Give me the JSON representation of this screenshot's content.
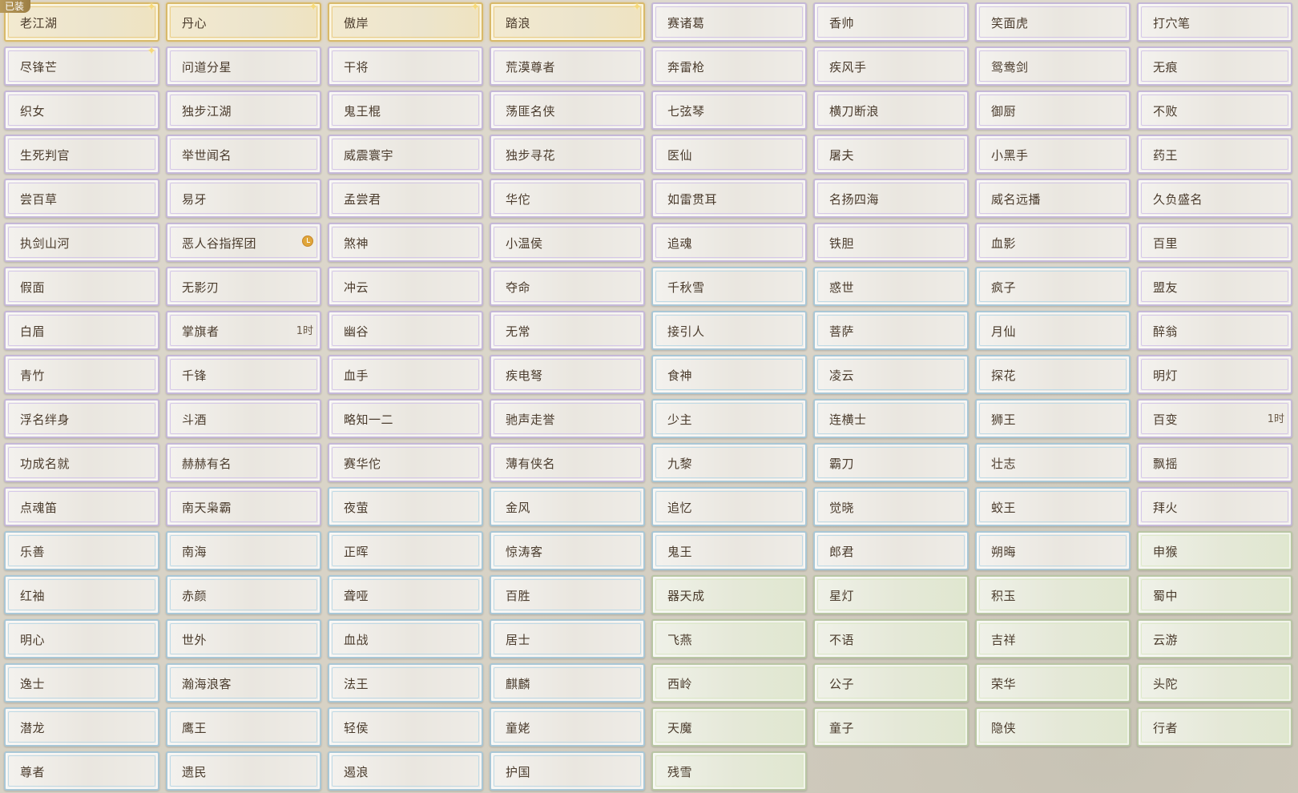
{
  "equipped_badge": "已装",
  "titles": [
    {
      "name": "老江湖",
      "style": "gold",
      "spark": true
    },
    {
      "name": "丹心",
      "style": "gold",
      "spark": true
    },
    {
      "name": "傲岸",
      "style": "gold",
      "spark": true
    },
    {
      "name": "踏浪",
      "style": "gold",
      "spark": true
    },
    {
      "name": "赛诸葛",
      "style": "purple"
    },
    {
      "name": "香帅",
      "style": "purple"
    },
    {
      "name": "笑面虎",
      "style": "purple"
    },
    {
      "name": "打穴笔",
      "style": "purple"
    },
    {
      "name": "尽锋芒",
      "style": "purple",
      "spark": true
    },
    {
      "name": "问道分星",
      "style": "purple"
    },
    {
      "name": "干将",
      "style": "purple"
    },
    {
      "name": "荒漠尊者",
      "style": "purple"
    },
    {
      "name": "奔雷枪",
      "style": "purple"
    },
    {
      "name": "疾风手",
      "style": "purple"
    },
    {
      "name": "鸳鸯剑",
      "style": "purple"
    },
    {
      "name": "无痕",
      "style": "purple"
    },
    {
      "name": "织女",
      "style": "purple"
    },
    {
      "name": "独步江湖",
      "style": "purple"
    },
    {
      "name": "鬼王棍",
      "style": "purple"
    },
    {
      "name": "荡匪名侠",
      "style": "purple"
    },
    {
      "name": "七弦琴",
      "style": "purple"
    },
    {
      "name": "横刀断浪",
      "style": "purple"
    },
    {
      "name": "御厨",
      "style": "purple"
    },
    {
      "name": "不败",
      "style": "purple"
    },
    {
      "name": "生死判官",
      "style": "purple"
    },
    {
      "name": "举世闻名",
      "style": "purple"
    },
    {
      "name": "威震寰宇",
      "style": "purple"
    },
    {
      "name": "独步寻花",
      "style": "purple"
    },
    {
      "name": "医仙",
      "style": "purple"
    },
    {
      "name": "屠夫",
      "style": "purple"
    },
    {
      "name": "小黑手",
      "style": "purple"
    },
    {
      "name": "药王",
      "style": "purple"
    },
    {
      "name": "尝百草",
      "style": "purple"
    },
    {
      "name": "易牙",
      "style": "purple"
    },
    {
      "name": "孟尝君",
      "style": "purple"
    },
    {
      "name": "华佗",
      "style": "purple"
    },
    {
      "name": "如雷贯耳",
      "style": "purple"
    },
    {
      "name": "名扬四海",
      "style": "purple"
    },
    {
      "name": "威名远播",
      "style": "purple"
    },
    {
      "name": "久负盛名",
      "style": "purple"
    },
    {
      "name": "执剑山河",
      "style": "purple"
    },
    {
      "name": "恶人谷指挥团",
      "style": "purple",
      "timer": true
    },
    {
      "name": "煞神",
      "style": "purple"
    },
    {
      "name": "小温侯",
      "style": "purple"
    },
    {
      "name": "追魂",
      "style": "purple"
    },
    {
      "name": "铁胆",
      "style": "purple"
    },
    {
      "name": "血影",
      "style": "purple"
    },
    {
      "name": "百里",
      "style": "purple"
    },
    {
      "name": "假面",
      "style": "purple"
    },
    {
      "name": "无影刃",
      "style": "purple"
    },
    {
      "name": "冲云",
      "style": "purple"
    },
    {
      "name": "夺命",
      "style": "purple"
    },
    {
      "name": "千秋雪",
      "style": "blue"
    },
    {
      "name": "惑世",
      "style": "blue"
    },
    {
      "name": "疯子",
      "style": "blue"
    },
    {
      "name": "盟友",
      "style": "purple"
    },
    {
      "name": "白眉",
      "style": "purple"
    },
    {
      "name": "掌旗者",
      "style": "purple",
      "duration": "1时"
    },
    {
      "name": "幽谷",
      "style": "purple"
    },
    {
      "name": "无常",
      "style": "purple"
    },
    {
      "name": "接引人",
      "style": "blue"
    },
    {
      "name": "菩萨",
      "style": "blue"
    },
    {
      "name": "月仙",
      "style": "blue"
    },
    {
      "name": "醉翁",
      "style": "purple"
    },
    {
      "name": "青竹",
      "style": "purple"
    },
    {
      "name": "千锋",
      "style": "purple"
    },
    {
      "name": "血手",
      "style": "purple"
    },
    {
      "name": "疾电弩",
      "style": "purple"
    },
    {
      "name": "食神",
      "style": "blue"
    },
    {
      "name": "凌云",
      "style": "blue"
    },
    {
      "name": "探花",
      "style": "blue"
    },
    {
      "name": "明灯",
      "style": "purple"
    },
    {
      "name": "浮名绊身",
      "style": "purple"
    },
    {
      "name": "斗酒",
      "style": "purple"
    },
    {
      "name": "略知一二",
      "style": "purple"
    },
    {
      "name": "驰声走誉",
      "style": "purple"
    },
    {
      "name": "少主",
      "style": "blue"
    },
    {
      "name": "连横士",
      "style": "blue"
    },
    {
      "name": "狮王",
      "style": "blue"
    },
    {
      "name": "百变",
      "style": "purple",
      "duration": "1时"
    },
    {
      "name": "功成名就",
      "style": "purple"
    },
    {
      "name": "赫赫有名",
      "style": "purple"
    },
    {
      "name": "赛华佗",
      "style": "purple"
    },
    {
      "name": "薄有侠名",
      "style": "purple"
    },
    {
      "name": "九黎",
      "style": "blue"
    },
    {
      "name": "霸刀",
      "style": "blue"
    },
    {
      "name": "壮志",
      "style": "blue"
    },
    {
      "name": "飘摇",
      "style": "purple"
    },
    {
      "name": "点魂笛",
      "style": "purple"
    },
    {
      "name": "南天枭霸",
      "style": "purple"
    },
    {
      "name": "夜萤",
      "style": "blue"
    },
    {
      "name": "金风",
      "style": "blue"
    },
    {
      "name": "追忆",
      "style": "blue"
    },
    {
      "name": "觉晓",
      "style": "blue"
    },
    {
      "name": "蛟王",
      "style": "blue"
    },
    {
      "name": "拜火",
      "style": "purple"
    },
    {
      "name": "乐善",
      "style": "blue"
    },
    {
      "name": "南海",
      "style": "blue"
    },
    {
      "name": "正晖",
      "style": "blue"
    },
    {
      "name": "惊涛客",
      "style": "blue"
    },
    {
      "name": "鬼王",
      "style": "blue"
    },
    {
      "name": "郎君",
      "style": "blue"
    },
    {
      "name": "朔晦",
      "style": "blue"
    },
    {
      "name": "申猴",
      "style": "green"
    },
    {
      "name": "红袖",
      "style": "blue"
    },
    {
      "name": "赤颜",
      "style": "blue"
    },
    {
      "name": "聋哑",
      "style": "blue"
    },
    {
      "name": "百胜",
      "style": "blue"
    },
    {
      "name": "器天成",
      "style": "green"
    },
    {
      "name": "星灯",
      "style": "green"
    },
    {
      "name": "积玉",
      "style": "green"
    },
    {
      "name": "蜀中",
      "style": "green"
    },
    {
      "name": "明心",
      "style": "blue"
    },
    {
      "name": "世外",
      "style": "blue"
    },
    {
      "name": "血战",
      "style": "blue"
    },
    {
      "name": "居士",
      "style": "blue"
    },
    {
      "name": "飞燕",
      "style": "green"
    },
    {
      "name": "不语",
      "style": "green"
    },
    {
      "name": "吉祥",
      "style": "green"
    },
    {
      "name": "云游",
      "style": "green"
    },
    {
      "name": "逸士",
      "style": "blue"
    },
    {
      "name": "瀚海浪客",
      "style": "blue"
    },
    {
      "name": "法王",
      "style": "blue"
    },
    {
      "name": "麒麟",
      "style": "blue"
    },
    {
      "name": "西岭",
      "style": "green"
    },
    {
      "name": "公子",
      "style": "green"
    },
    {
      "name": "荣华",
      "style": "green"
    },
    {
      "name": "头陀",
      "style": "green"
    },
    {
      "name": "潜龙",
      "style": "blue"
    },
    {
      "name": "鹰王",
      "style": "blue"
    },
    {
      "name": "轻侯",
      "style": "blue"
    },
    {
      "name": "童姥",
      "style": "blue"
    },
    {
      "name": "天魔",
      "style": "green"
    },
    {
      "name": "童子",
      "style": "green"
    },
    {
      "name": "隐侠",
      "style": "green"
    },
    {
      "name": "行者",
      "style": "green"
    },
    {
      "name": "尊者",
      "style": "blue"
    },
    {
      "name": "遗民",
      "style": "blue"
    },
    {
      "name": "遏浪",
      "style": "blue"
    },
    {
      "name": "护国",
      "style": "blue"
    },
    {
      "name": "残雪",
      "style": "green"
    }
  ]
}
